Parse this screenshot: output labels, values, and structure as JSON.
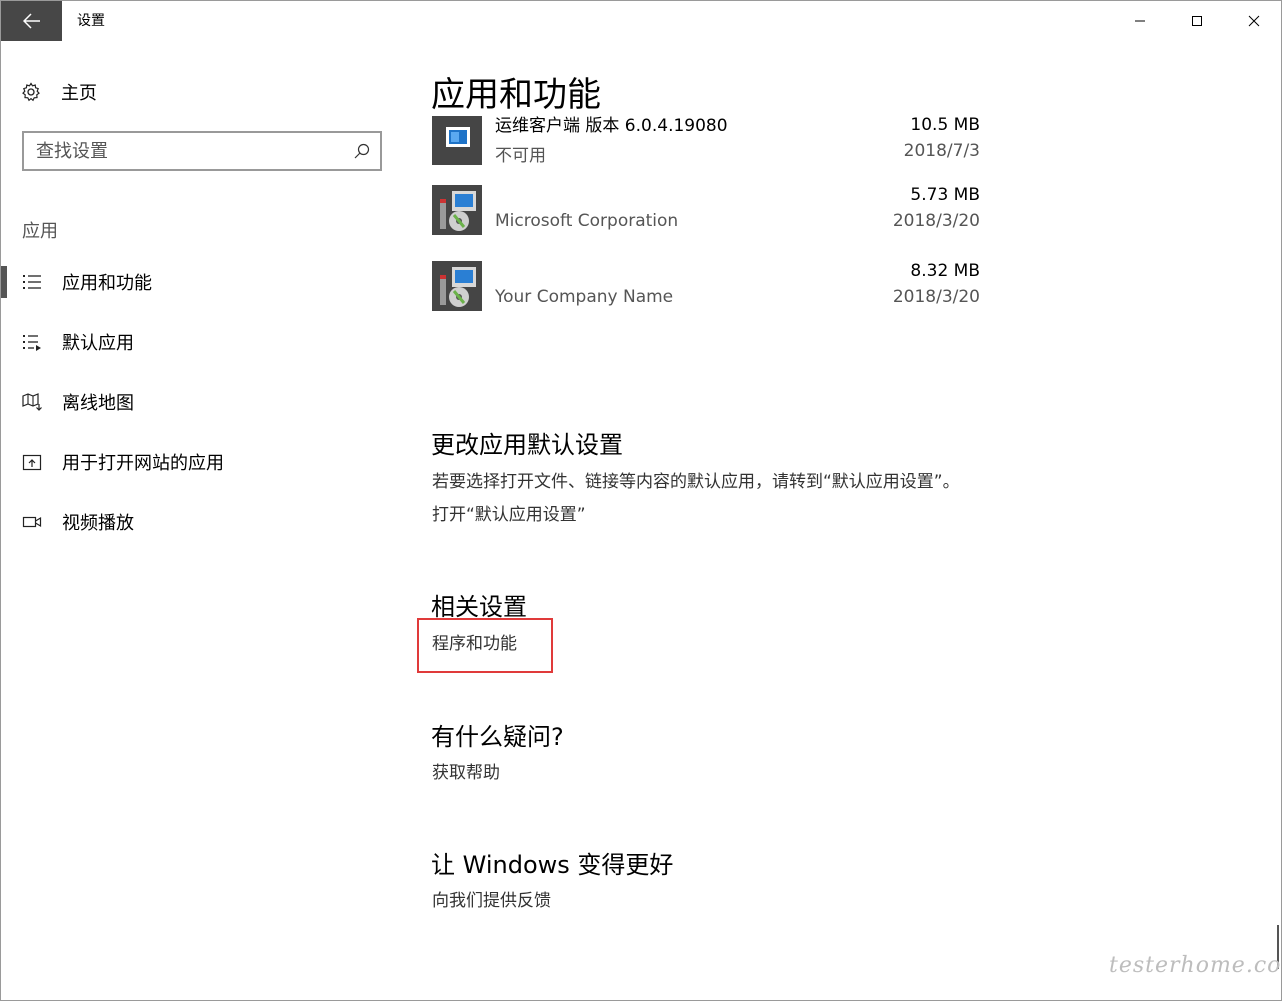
{
  "window": {
    "title": "设置",
    "colors": {
      "back_bg": "#474747",
      "highlight": "#e03a3a"
    }
  },
  "nav": {
    "home_label": "主页",
    "search_placeholder": "查找设置",
    "section_label": "应用",
    "items": [
      {
        "label": "应用和功能",
        "icon": "apps-features-icon",
        "selected": true
      },
      {
        "label": "默认应用",
        "icon": "default-apps-icon",
        "selected": false
      },
      {
        "label": "离线地图",
        "icon": "offline-maps-icon",
        "selected": false
      },
      {
        "label": "用于打开网站的应用",
        "icon": "apps-for-websites-icon",
        "selected": false
      },
      {
        "label": "视频播放",
        "icon": "video-playback-icon",
        "selected": false
      }
    ]
  },
  "main": {
    "title": "应用和功能",
    "apps": [
      {
        "name": "运维客户端 版本 6.0.4.19080",
        "publisher": "不可用",
        "size": "10.5 MB",
        "date": "2018/7/3",
        "icon": "client-app-icon"
      },
      {
        "name": "",
        "publisher": "Microsoft Corporation",
        "size": "5.73 MB",
        "date": "2018/3/20",
        "icon": "installer-icon"
      },
      {
        "name": "",
        "publisher": "Your Company Name",
        "size": "8.32 MB",
        "date": "2018/3/20",
        "icon": "installer-icon"
      }
    ],
    "defaults": {
      "heading": "更改应用默认设置",
      "description": "若要选择打开文件、链接等内容的默认应用，请转到“默认应用设置”。",
      "link": "打开“默认应用设置”"
    },
    "related": {
      "heading": "相关设置",
      "link": "程序和功能"
    },
    "help": {
      "heading": "有什么疑问?",
      "link": "获取帮助"
    },
    "feedback": {
      "heading": "让 Windows 变得更好",
      "link": "向我们提供反馈"
    }
  },
  "watermark": "testerhome.com"
}
